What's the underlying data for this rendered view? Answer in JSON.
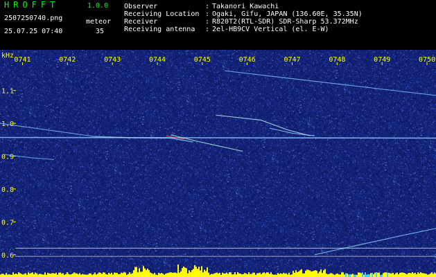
{
  "app": {
    "title": "HROFFT",
    "version": "1.0.0"
  },
  "file": {
    "name": "2507250740.png",
    "datetime": "25.07.25 07:40"
  },
  "meteor": {
    "label": "meteor",
    "count": "35"
  },
  "info": [
    {
      "label": "Observer",
      "value": "Takanori Kawachi"
    },
    {
      "label": "Receiving Location",
      "value": "Ogaki, Gifu, JAPAN (136.60E, 35.35N)"
    },
    {
      "label": "Receiver",
      "value": "R820T2(RTL-SDR) SDR-Sharp 53.372MHz"
    },
    {
      "label": "Receiving antenna",
      "value": "2el-HB9CV Vertical (el. E-W)"
    }
  ],
  "colors": {
    "label_green": "#00ff00",
    "time_yellow": "#ffff00",
    "background_blue": "#101a6a",
    "header_bg": "#000000"
  },
  "chart_data": {
    "type": "heatmap",
    "ylabel": "kHz",
    "y_ticks": [
      "1.1",
      "1.0",
      "0.9",
      "0.8",
      "0.7",
      "0.6"
    ],
    "y_tick_values": [
      1.1,
      1.0,
      0.9,
      0.8,
      0.7,
      0.6
    ],
    "x_ticks": [
      "0741",
      "0742",
      "0743",
      "0744",
      "0745",
      "0746",
      "0747",
      "0748",
      "0749",
      "0750"
    ],
    "ylim": [
      0.57,
      1.19
    ],
    "xlim": [
      740.5,
      750.2
    ],
    "traces": [
      {
        "points": [
          [
            740.5,
            0.957
          ],
          [
            750.2,
            0.955
          ]
        ]
      },
      {
        "points": [
          [
            742.6,
            0.96
          ],
          [
            743.5,
            0.956
          ],
          [
            744.3,
            0.955
          ],
          [
            744.8,
            0.943
          ]
        ]
      },
      {
        "points": [
          [
            744.3,
            0.965
          ],
          [
            744.9,
            0.945
          ],
          [
            745.9,
            0.915
          ]
        ]
      },
      {
        "points": [
          [
            744.2,
            0.962
          ],
          [
            744.6,
            0.952
          ]
        ]
      },
      {
        "points": [
          [
            745.3,
            1.025
          ],
          [
            746.3,
            1.01
          ],
          [
            746.9,
            0.98
          ],
          [
            747.4,
            0.962
          ]
        ]
      },
      {
        "points": [
          [
            746.5,
            0.985
          ],
          [
            747.0,
            0.97
          ],
          [
            747.5,
            0.962
          ]
        ]
      },
      {
        "points": [
          [
            740.6,
            0.905
          ],
          [
            741.2,
            0.895
          ],
          [
            741.7,
            0.89
          ]
        ]
      },
      {
        "points": [
          [
            740.5,
            1.0
          ],
          [
            742.6,
            0.96
          ]
        ]
      },
      {
        "points": [
          [
            745.5,
            1.16
          ],
          [
            750.2,
            1.085
          ]
        ]
      },
      {
        "points": [
          [
            747.5,
            0.6
          ],
          [
            748.5,
            0.63
          ],
          [
            749.5,
            0.66
          ],
          [
            750.2,
            0.68
          ]
        ]
      }
    ],
    "threshold_lines": [
      0.62,
      0.595
    ]
  }
}
